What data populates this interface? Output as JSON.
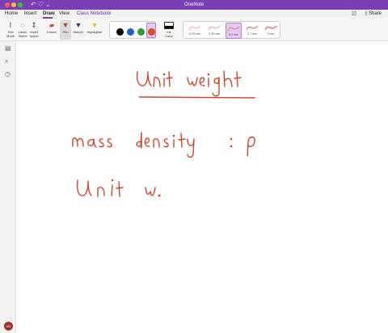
{
  "app": {
    "title": "OneNote"
  },
  "tabs": [
    {
      "label": "Home"
    },
    {
      "label": "Insert"
    },
    {
      "label": "Draw"
    },
    {
      "label": "View"
    },
    {
      "label": "Class Notebook"
    }
  ],
  "active_tab": "Draw",
  "share_label": "Share",
  "tools": [
    {
      "label_1": "Text",
      "label_2": "Mode",
      "icon": "text-mode-icon"
    },
    {
      "label_1": "Lasso",
      "label_2": "Select",
      "icon": "lasso-icon"
    },
    {
      "label_1": "Insert",
      "label_2": "Space",
      "icon": "insert-space-icon"
    },
    {
      "label_1": "Eraser",
      "label_2": "",
      "icon": "eraser-icon"
    },
    {
      "label_1": "Pen",
      "label_2": "",
      "icon": "pen-icon"
    },
    {
      "label_1": "Marker",
      "label_2": "",
      "icon": "marker-icon"
    },
    {
      "label_1": "Highlighter",
      "label_2": "",
      "icon": "highlighter-icon"
    }
  ],
  "pen_colors": [
    "#000000",
    "#1a5fd6",
    "#2e9a3a",
    "#e0472b"
  ],
  "selected_color": "#e0472b",
  "ink_color_label_1": "Ink",
  "ink_color_label_2": "Color",
  "thickness": [
    {
      "label": "0.25 mm"
    },
    {
      "label": "0.35 mm"
    },
    {
      "label": "0.5 mm"
    },
    {
      "label": "0.7 mm"
    },
    {
      "label": "1 mm"
    }
  ],
  "selected_thickness": "0.5 mm",
  "avatar_initials": "HD",
  "note": {
    "ink_color": "#d2442a",
    "heading": "Unit weight",
    "line_1": "mass density : ρ",
    "line_2": "Unit w."
  }
}
